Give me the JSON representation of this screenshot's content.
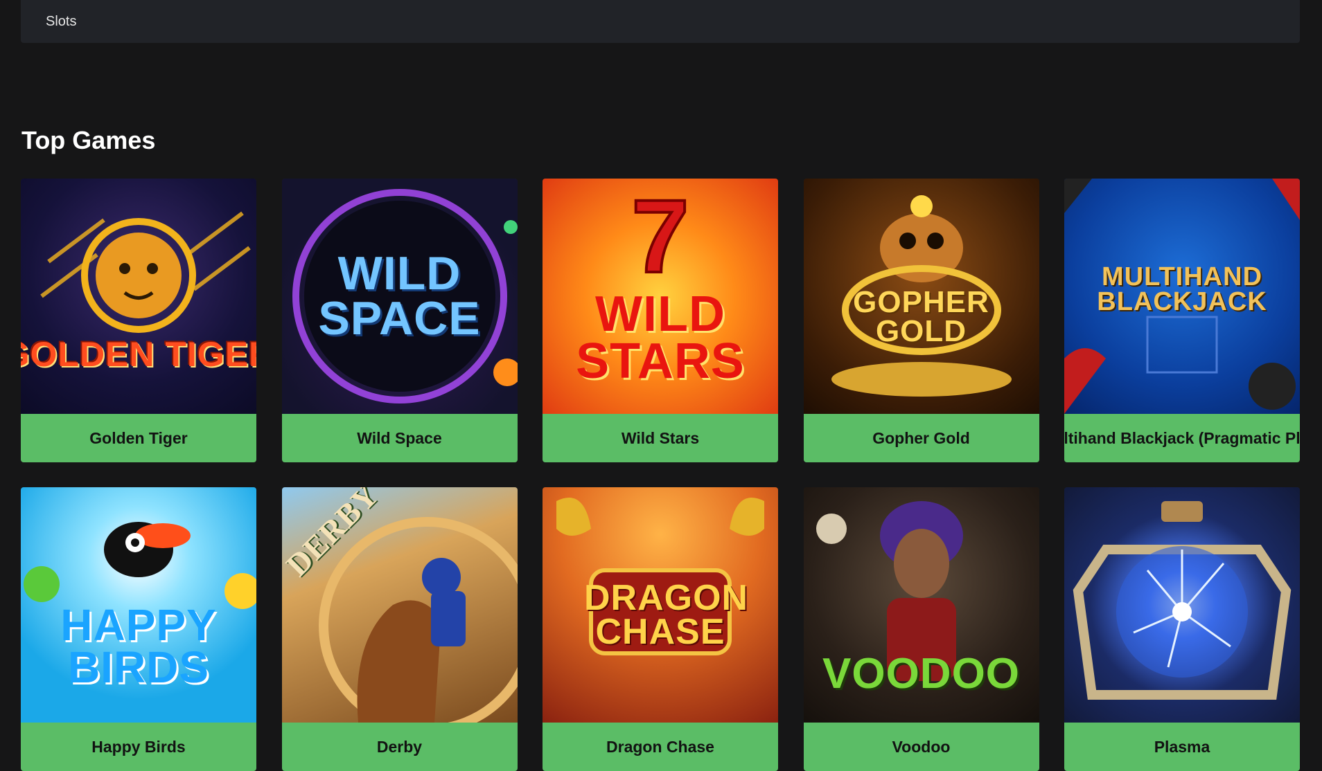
{
  "topbar": {
    "text": "Slots"
  },
  "section": {
    "title": "Top Games"
  },
  "games": [
    {
      "name": "Golden Tiger",
      "art_text": "GOLDEN TIGER",
      "icon": "golden-tiger-thumbnail"
    },
    {
      "name": "Wild Space",
      "art_text": "WILD SPACE",
      "icon": "wild-space-thumbnail"
    },
    {
      "name": "Wild Stars",
      "art_text": "WILD STARS",
      "icon": "wild-stars-thumbnail"
    },
    {
      "name": "Gopher Gold",
      "art_text": "GOPHER GOLD",
      "icon": "gopher-gold-thumbnail"
    },
    {
      "name": "Multihand Blackjack (Pragmatic Play)",
      "art_text": "MULTIHAND BLACKJACK",
      "icon": "multihand-blackjack-thumbnail"
    },
    {
      "name": "Happy Birds",
      "art_text": "HAPPY BIRDS",
      "icon": "happy-birds-thumbnail"
    },
    {
      "name": "Derby",
      "art_text": "DERBY",
      "icon": "derby-thumbnail"
    },
    {
      "name": "Dragon Chase",
      "art_text": "DRAGON CHASE",
      "icon": "dragon-chase-thumbnail"
    },
    {
      "name": "Voodoo",
      "art_text": "VOODOO",
      "icon": "voodoo-thumbnail"
    },
    {
      "name": "Plasma",
      "art_text": "",
      "icon": "plasma-ball-thumbnail"
    }
  ],
  "colors": {
    "background": "#161617",
    "topbar": "#212328",
    "label_bg": "#5bbd66",
    "label_text": "#121212"
  }
}
